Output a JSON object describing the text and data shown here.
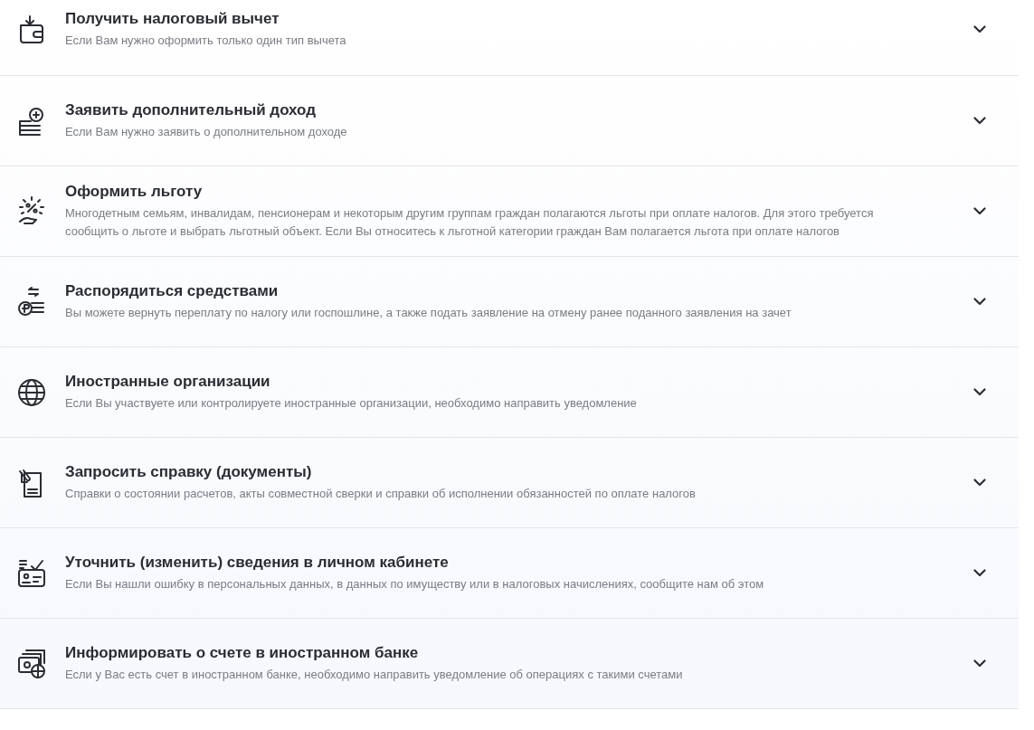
{
  "services": [
    {
      "title": "Получить налоговый вычет",
      "description": "Если Вам нужно оформить только один тип вычета",
      "expanded": false
    },
    {
      "title": "Заявить дополнительный доход",
      "description": "Если Вам нужно заявить о дополнительном доходе",
      "expanded": false
    },
    {
      "title": "Оформить льготу",
      "description": "Многодетным семьям, инвалидам, пенсионерам и некоторым другим группам граждан полагаются льготы при оплате налогов. Для этого требуется сообщить о льготе и выбрать льготный объект. Если Вы относитесь к льготной категории граждан Вам полагается льгота при оплате налогов",
      "expanded": false
    },
    {
      "title": "Распорядиться средствами",
      "description": "Вы можете вернуть переплату по налогу или госпошлине, а также подать заявление на отмену ранее поданного заявления на зачет",
      "expanded": false
    },
    {
      "title": "Иностранные организации",
      "description": "Если Вы участвуете или контролируете иностранные организации, необходимо направить уведомление",
      "expanded": false
    },
    {
      "title": "Запросить справку (документы)",
      "description": "Справки о состоянии расчетов, акты совместной сверки и справки об исполнении обязанностей по оплате налогов",
      "expanded": false
    },
    {
      "title": "Уточнить (изменить) сведения в личном кабинете",
      "description": "Если Вы нашли ошибку в персональных данных, в данных по имуществу или в налоговых начислениях, сообщите нам об этом",
      "expanded": false
    },
    {
      "title": "Информировать о счете в иностранном банке",
      "description": "Если у Вас есть счет в иностранном банке, необходимо направить уведомление об операциях с такими счетами",
      "expanded": false
    }
  ]
}
